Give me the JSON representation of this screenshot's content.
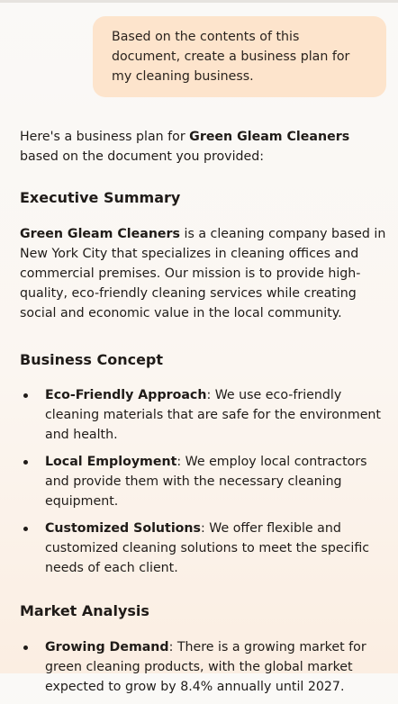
{
  "user_message": "Based on the contents of this document, create a business plan for my cleaning business.",
  "response": {
    "intro_pre": "Here's a business plan for ",
    "intro_company": "Green Gleam Cleaners",
    "intro_post": " based on the document you provided:",
    "sections": {
      "executive_summary": {
        "heading": "Executive Summary",
        "company": "Green Gleam Cleaners",
        "text": " is a cleaning company based in New York City that specializes in cleaning offices and commercial premises. Our mission is to provide high-quality, eco-friendly cleaning services while creating social and economic value in the local community."
      },
      "business_concept": {
        "heading": "Business Concept",
        "items": [
          {
            "term": "Eco-Friendly Approach",
            "text": ": We use eco-friendly cleaning materials that are safe for the environment and health."
          },
          {
            "term": "Local Employment",
            "text": ": We employ local contractors and provide them with the necessary cleaning equipment."
          },
          {
            "term": "Customized Solutions",
            "text": ": We offer flexible and customized cleaning solutions to meet the specific needs of each client."
          }
        ]
      },
      "market_analysis": {
        "heading": "Market Analysis",
        "items": [
          {
            "term": "Growing Demand",
            "text": ": There is a growing market for green cleaning products, with the global market expected to grow by 8.4% annually until 2027."
          }
        ]
      }
    }
  }
}
